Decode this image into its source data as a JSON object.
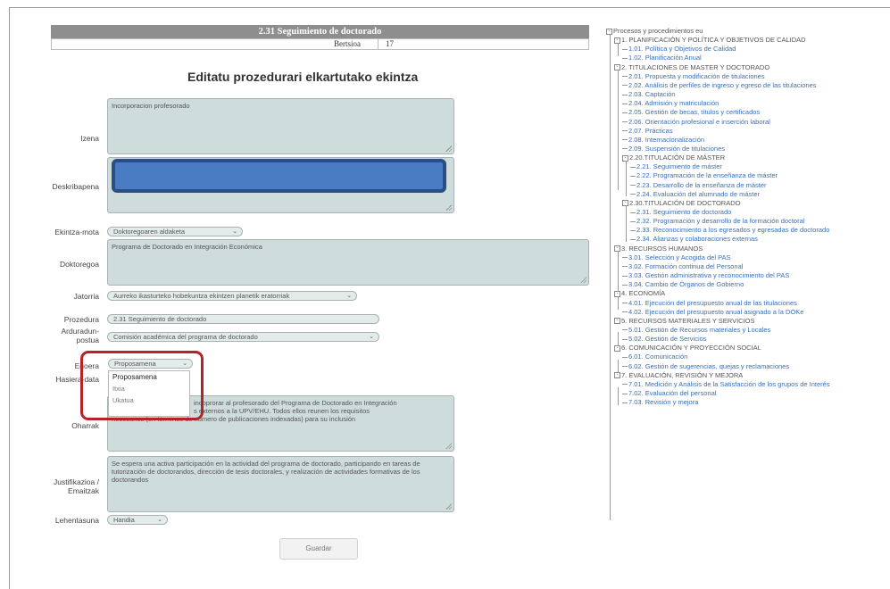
{
  "header": {
    "title": "2.31 Seguimiento de doctorado",
    "version_label": "Bertsioa",
    "version_value": "17"
  },
  "form": {
    "heading": "Editatu prozedurari elkartutako ekintza",
    "labels": {
      "izena": "Izena",
      "deskribapena": "Deskribapena",
      "ekintza_mota": "Ekintza-mota",
      "doktoregoa": "Doktoregoa",
      "jatorria": "Jatorria",
      "prozedura": "Prozedura",
      "arduradun_1": "Arduradun-",
      "arduradun_2": "postua",
      "egoera": "Egoera",
      "hasiera_data": "Hasiera-data",
      "oharrak": "Oharrak",
      "justifikazioa_1": "Justifikazioa /",
      "justifikazioa_2": "Emaitzak",
      "lehentasuna": "Lehentasuna"
    },
    "values": {
      "izena": "Incorporacion profesorado",
      "ekintza_mota": "Doktoregoaren aldaketa",
      "doktoregoa": "Programa de Doctorado en Integración Económica",
      "jatorria": "Aurreko ikasturteko hobekuntza ekintzen planetik eratorriak",
      "prozedura": "2.31 Seguimiento de doctorado",
      "arduradun": "Comisión académica del programa de doctorado",
      "egoera": "Proposamena",
      "oharrak_line1": "incoprorar al profesorado del Programa de Doctorado en Integración",
      "oharrak_line2": "s externos a la UPV/EHU. Todos ellos reunen los requisitos",
      "oharrak_line3": "necesarios (en términos de número de publicaciones indexadas) para su inclusión",
      "justifikazioa": "Se espera una activa participación en la actividad del programa de doctorado, participando en tareas de tutorización de doctorandos, dirección de tesis doctorales, y realización de actividades formativas de los doctorandos",
      "lehentasuna": "Handia"
    },
    "egoera_options": [
      "Proposamena",
      "Itxia",
      "Ukatua"
    ],
    "save_button": "Guardar"
  },
  "tree": {
    "items": [
      {
        "text": "Procesos y procedimientos eu",
        "level": 0,
        "kind": "head",
        "exp": "-"
      },
      {
        "text": "1. PLANIFICACIÓN Y POLÍTICA Y OBJETIVOS DE CALIDAD",
        "level": 1,
        "kind": "head",
        "exp": "-"
      },
      {
        "text": "1.01. Política y Objetivos de Calidad",
        "level": 2,
        "kind": "link"
      },
      {
        "text": "1.02. Planificación Anual",
        "level": 2,
        "kind": "link"
      },
      {
        "text": "2. TITULACIONES DE MASTER Y DOCTORADO",
        "level": 1,
        "kind": "head",
        "exp": "-"
      },
      {
        "text": "2.01. Propuesta y modificación de titulaciones",
        "level": 2,
        "kind": "link"
      },
      {
        "text": "2.02. Análisis de perfiles de ingreso y egreso de las titulaciones",
        "level": 2,
        "kind": "link"
      },
      {
        "text": "2.03. Captación",
        "level": 2,
        "kind": "link"
      },
      {
        "text": "2.04. Admisión y matriculación",
        "level": 2,
        "kind": "link"
      },
      {
        "text": "2.05. Gestión de becas, títulos y certificados",
        "level": 2,
        "kind": "link"
      },
      {
        "text": "2.06. Orientación profesional e inserción laboral",
        "level": 2,
        "kind": "link"
      },
      {
        "text": "2.07. Prácticas",
        "level": 2,
        "kind": "link"
      },
      {
        "text": "2.08. Internacionalización",
        "level": 2,
        "kind": "link"
      },
      {
        "text": "2.09. Suspensión de titulaciones",
        "level": 2,
        "kind": "link"
      },
      {
        "text": "2.20.TITULACIÓN DE MÁSTER",
        "level": 2,
        "kind": "head",
        "exp": "-"
      },
      {
        "text": "2.21. Seguimiento de máster",
        "level": 3,
        "kind": "link"
      },
      {
        "text": "2.22. Programación de la enseñanza de máster",
        "level": 3,
        "kind": "link"
      },
      {
        "text": "2.23. Desarrollo de la enseñanza de máster",
        "level": 3,
        "kind": "link"
      },
      {
        "text": "2.24. Evaluación del alumnado de máster",
        "level": 3,
        "kind": "link"
      },
      {
        "text": "2.30.TITULACIÓN DE DOCTORADO",
        "level": 2,
        "kind": "head",
        "exp": "-"
      },
      {
        "text": "2.31. Seguimiento de doctorado",
        "level": 3,
        "kind": "link"
      },
      {
        "text": "2.32. Programación y desarrollo de la formación doctoral",
        "level": 3,
        "kind": "link"
      },
      {
        "text": "2.33. Reconocimiento a los egresados y egresadas de doctorado",
        "level": 3,
        "kind": "link"
      },
      {
        "text": "2.34. Alianzas y colaboraciones externas",
        "level": 3,
        "kind": "link"
      },
      {
        "text": "3. RECURSOS HUMANOS",
        "level": 1,
        "kind": "head",
        "exp": "-"
      },
      {
        "text": "3.01. Selección y Acogida del PAS",
        "level": 2,
        "kind": "link"
      },
      {
        "text": "3.02. Formación continua del Personal",
        "level": 2,
        "kind": "link"
      },
      {
        "text": "3.03. Gestión administrativa y reconocimiento del PAS",
        "level": 2,
        "kind": "link"
      },
      {
        "text": "3.04. Cambio de Órganos de Gobierno",
        "level": 2,
        "kind": "link"
      },
      {
        "text": "4. ECONOMÍA",
        "level": 1,
        "kind": "head",
        "exp": "-"
      },
      {
        "text": "4.01. Ejecución del presupuesto anual de las titulaciones",
        "level": 2,
        "kind": "link"
      },
      {
        "text": "4.02. Ejecución del presupuesto anual asignado a la DOKe",
        "level": 2,
        "kind": "link"
      },
      {
        "text": "5. RECURSOS MATERIALES Y SERVICIOS",
        "level": 1,
        "kind": "head",
        "exp": "-"
      },
      {
        "text": "5.01. Gestión de Recursos materiales y Locales",
        "level": 2,
        "kind": "link"
      },
      {
        "text": "5.02. Gestión de Servicios",
        "level": 2,
        "kind": "link"
      },
      {
        "text": "6. COMUNICACIÓN Y PROYECCIÓN SOCIAL",
        "level": 1,
        "kind": "head",
        "exp": "-"
      },
      {
        "text": "6.01. Comunicación",
        "level": 2,
        "kind": "link"
      },
      {
        "text": "6.02. Gestión de sugerencias, quejas y reclamaciones",
        "level": 2,
        "kind": "link"
      },
      {
        "text": "7. EVALUACIÓN, REVISIÓN Y MEJORA",
        "level": 1,
        "kind": "head",
        "exp": "-"
      },
      {
        "text": "7.01. Medición y Análisis de la Satisfacción de los grupos de Interés",
        "level": 2,
        "kind": "link"
      },
      {
        "text": "7.02. Evaluación del personal",
        "level": 2,
        "kind": "link"
      },
      {
        "text": "7.03. Revisión y mejora",
        "level": 2,
        "kind": "link"
      }
    ]
  },
  "colors": {
    "field_bg": "#cfdcdc",
    "header_bg": "#8e8e8e",
    "tree_link": "#3a6fb8",
    "callout": "#b5222a",
    "redaction_fill": "#4a7cc4"
  }
}
